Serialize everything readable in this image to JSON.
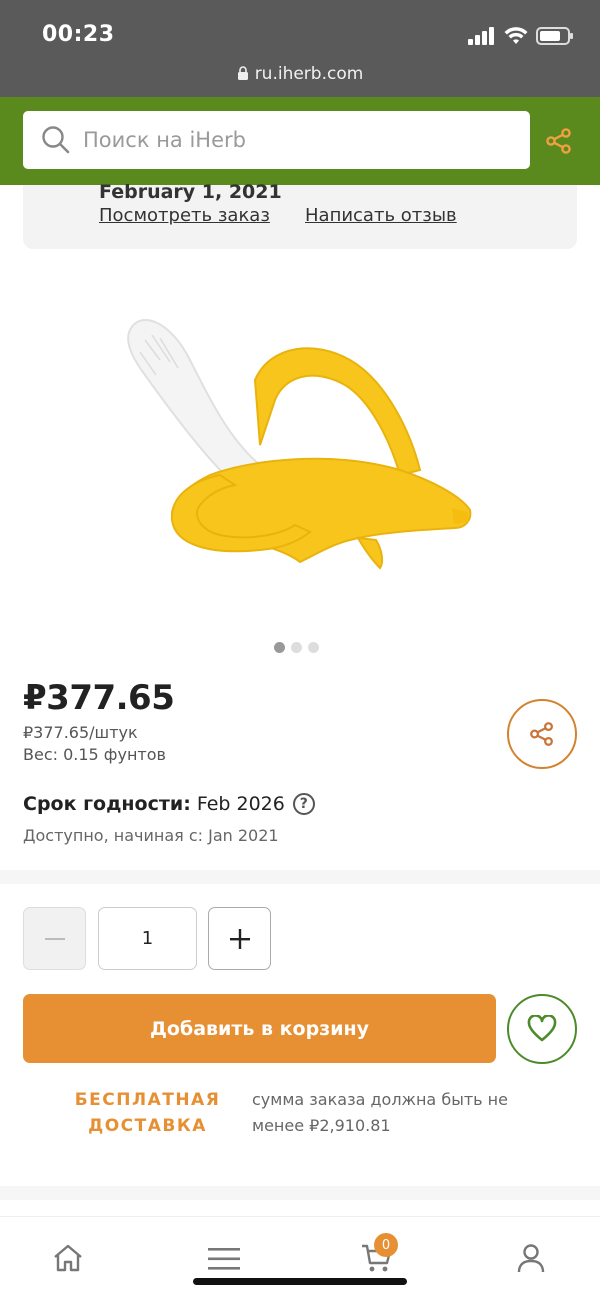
{
  "status_bar": {
    "time": "00:23",
    "url": "ru.iherb.com"
  },
  "search": {
    "placeholder": "Поиск на iHerb"
  },
  "order": {
    "date": "February 1, 2021",
    "view_order_link": "Посмотреть заказ",
    "write_review_link": "Написать отзыв"
  },
  "product": {
    "image_icon": "banana-toothbrush-image",
    "carousel_dots": 3,
    "carousel_active": 1,
    "price": "₽377.65",
    "unit_price": "₽377.65/штук",
    "weight": "Вес: 0.15 фунтов",
    "expiry_label": "Срок годности:",
    "expiry_value": "Feb 2026",
    "help_icon": "?",
    "available": "Доступно, начиная с: Jan 2021"
  },
  "quantity": {
    "value": "1"
  },
  "actions": {
    "add_to_cart": "Добавить в корзину",
    "free_shipping_line1": "БЕСПЛАТНАЯ",
    "free_shipping_line2": "ДОСТАВКА",
    "free_shipping_note": "сумма заказа должна быть не менее ₽2,910.81"
  },
  "bottom_nav": {
    "cart_count": "0"
  },
  "colors": {
    "header_green": "#5a8a1e",
    "accent_orange": "#e79033",
    "favorite_green": "#4c8a2a"
  }
}
